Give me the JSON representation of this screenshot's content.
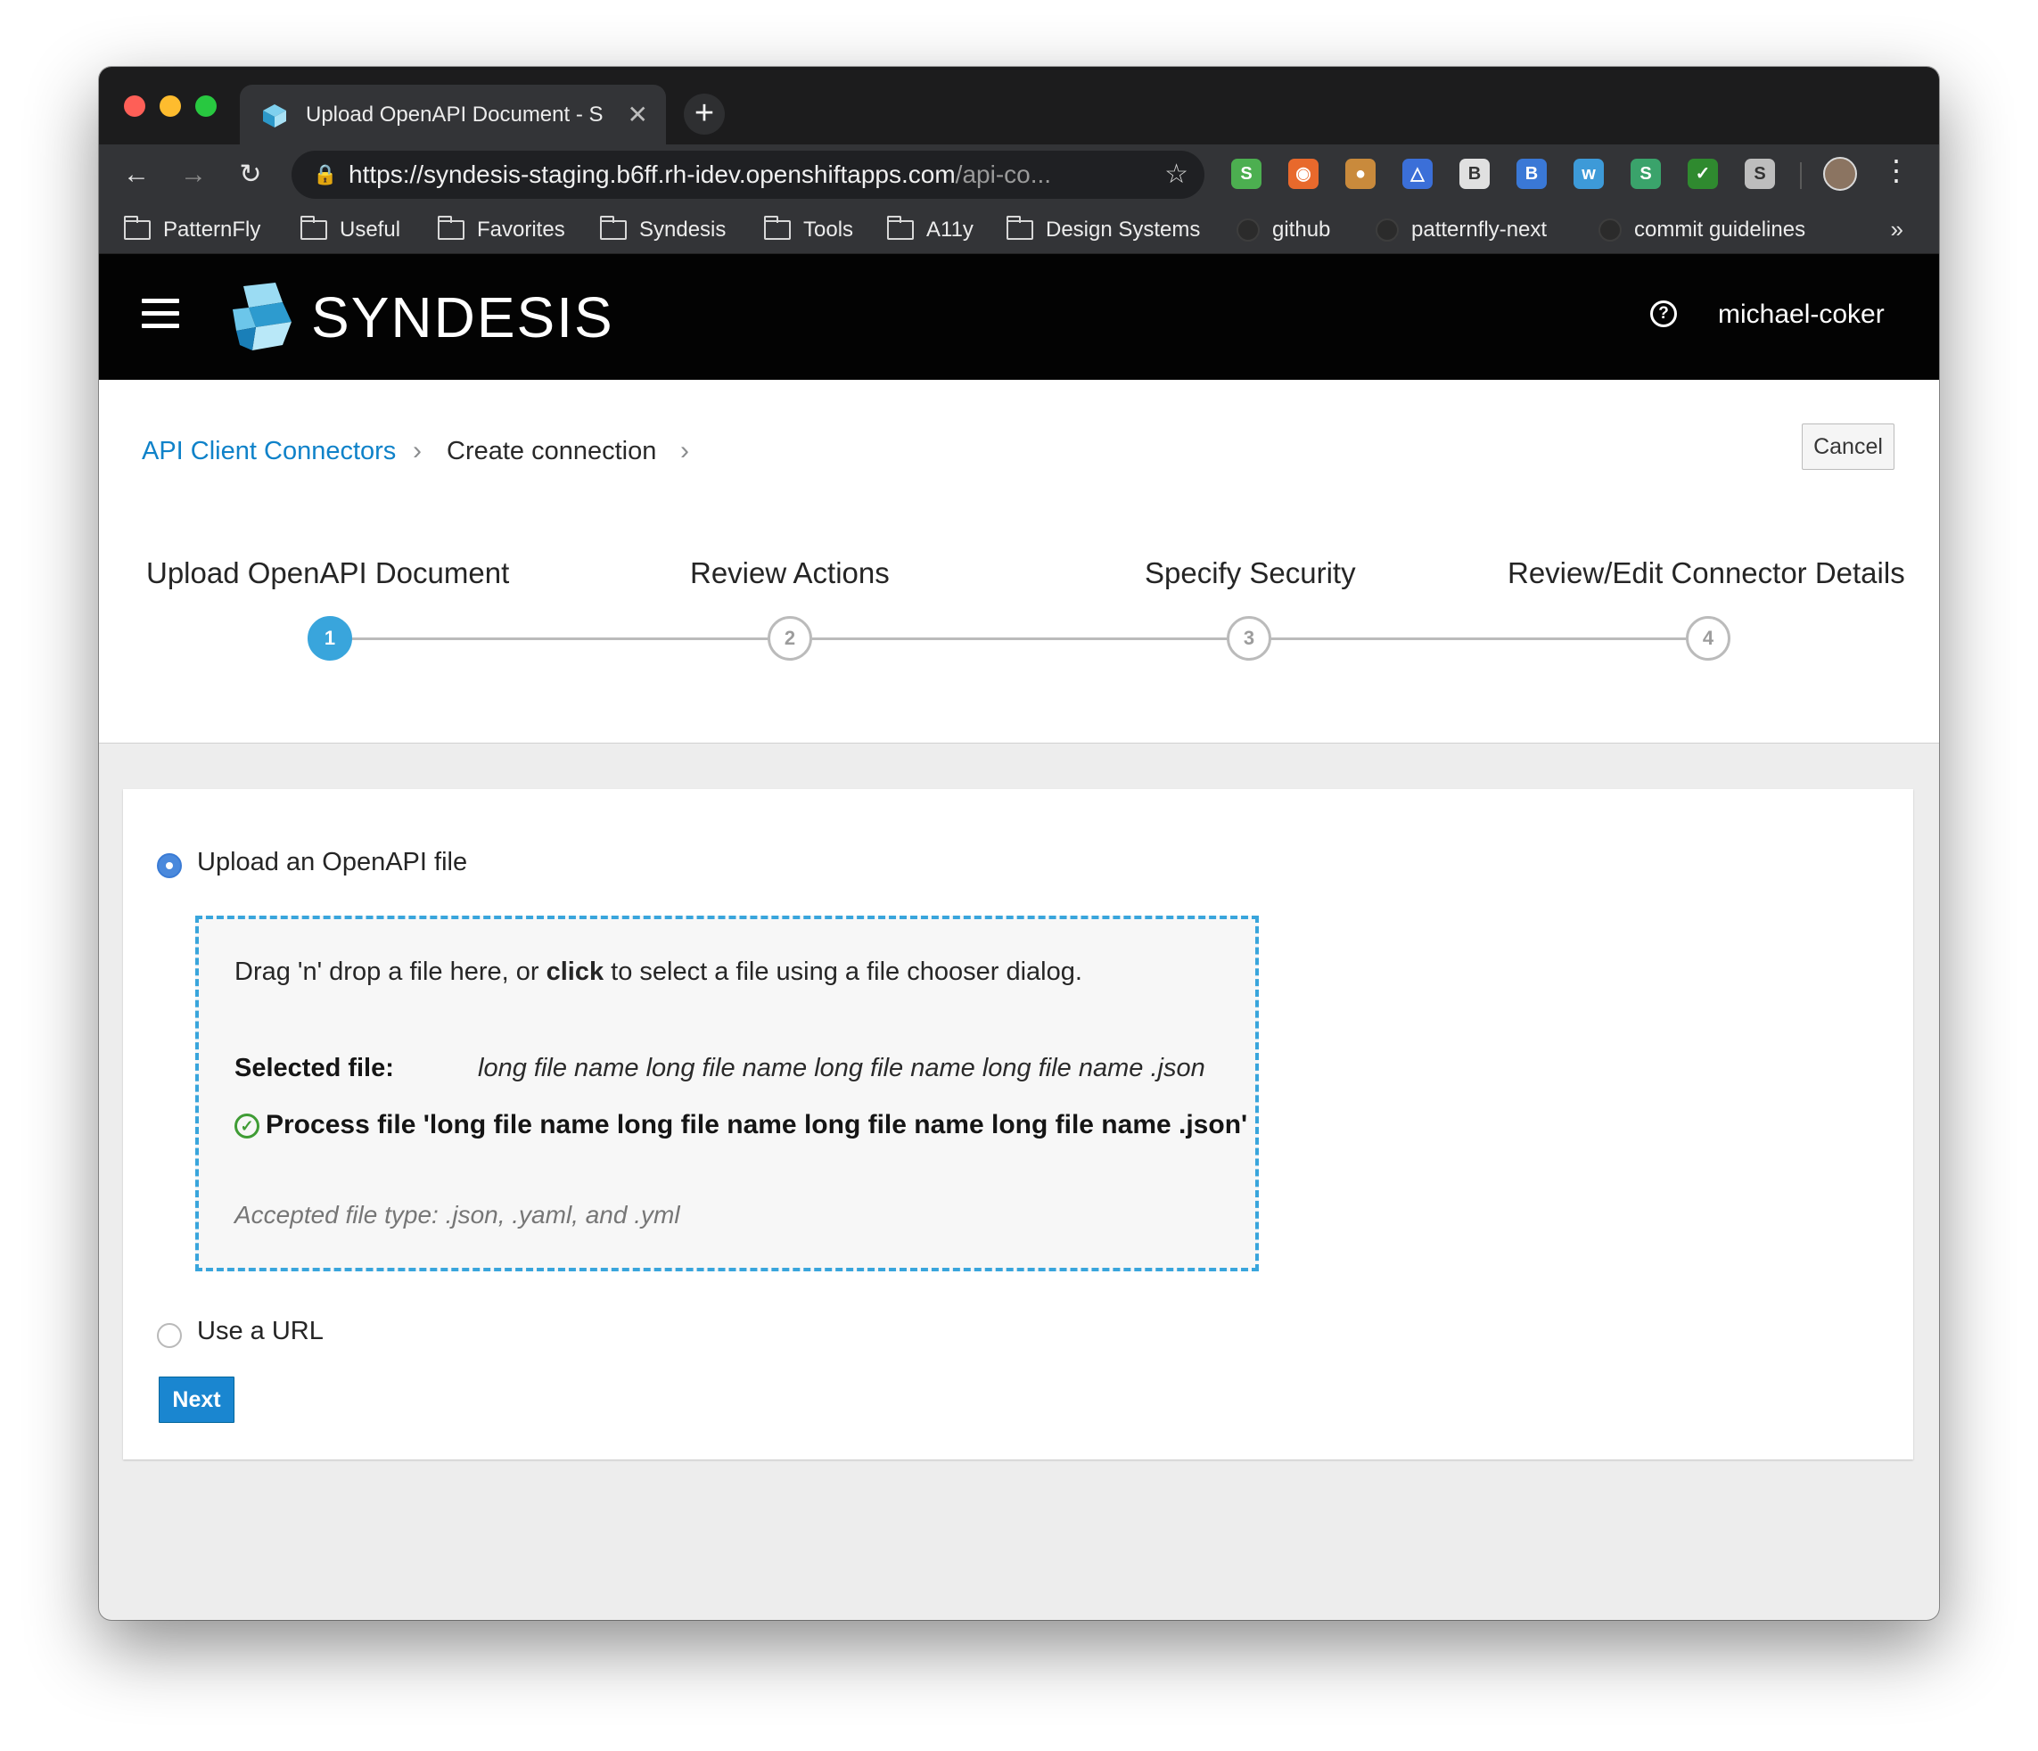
{
  "browser": {
    "tab_title": "Upload OpenAPI Document - S",
    "tab_close": "✕",
    "new_tab": "+",
    "url_main": "https://syndesis-staging.b6ff.rh-idev.openshiftapps.com",
    "url_rest": "/api-co...",
    "back": "←",
    "forward": "→",
    "reload": "↻",
    "lock": "🔒",
    "star": "☆",
    "menu": "⋮",
    "extensions": [
      {
        "name": "s-logo-icon",
        "glyph": "S",
        "color": "#4caf50"
      },
      {
        "name": "firefox-like-icon",
        "glyph": "◉",
        "color": "#e8692c"
      },
      {
        "name": "cookie-icon",
        "glyph": "●",
        "color": "#c98a3c"
      },
      {
        "name": "triangle-icon",
        "glyph": "△",
        "color": "#3b6fd8"
      },
      {
        "name": "b-box-icon",
        "glyph": "B",
        "color": "#e0e0e0"
      },
      {
        "name": "bi-icon",
        "glyph": "B",
        "color": "#3a78d6"
      },
      {
        "name": "walkme-icon",
        "glyph": "w",
        "color": "#3d9ad8"
      },
      {
        "name": "s-green-icon",
        "glyph": "S",
        "color": "#3aa36b"
      },
      {
        "name": "check-icon",
        "glyph": "✓",
        "color": "#2f8a2f"
      },
      {
        "name": "s-gray-icon",
        "glyph": "S",
        "color": "#bdbdbd"
      }
    ]
  },
  "bookmarks": {
    "items": [
      {
        "label": "PatternFly",
        "type": "folder"
      },
      {
        "label": "Useful",
        "type": "folder"
      },
      {
        "label": "Favorites",
        "type": "folder"
      },
      {
        "label": "Syndesis",
        "type": "folder"
      },
      {
        "label": "Tools",
        "type": "folder"
      },
      {
        "label": "A11y",
        "type": "folder"
      },
      {
        "label": "Design Systems",
        "type": "folder"
      },
      {
        "label": "github",
        "type": "github"
      },
      {
        "label": "patternfly-next",
        "type": "github"
      },
      {
        "label": "commit guidelines",
        "type": "github"
      }
    ],
    "more": "»"
  },
  "masthead": {
    "brand": "SYNDESIS",
    "help_glyph": "?",
    "username": "michael-coker"
  },
  "breadcrumb": {
    "link": "API Client Connectors",
    "current": "Create connection",
    "sep": "›"
  },
  "cancel_label": "Cancel",
  "wizard": {
    "steps": [
      {
        "label": "Upload OpenAPI Document",
        "number": "1",
        "active": true
      },
      {
        "label": "Review Actions",
        "number": "2",
        "active": false
      },
      {
        "label": "Specify Security",
        "number": "3",
        "active": false
      },
      {
        "label": "Review/Edit Connector Details",
        "number": "4",
        "active": false
      }
    ]
  },
  "upload": {
    "option_file": "Upload an OpenAPI file",
    "option_url": "Use a URL",
    "drop_prefix": "Drag 'n' drop a file here, or ",
    "drop_bold": "click",
    "drop_suffix": " to select a file using a file chooser dialog.",
    "selected_label": "Selected file:",
    "selected_value": "long file name long file name long file name long file name .json",
    "process_text": "Process file 'long file name long file name long file name long file name .json'",
    "ok_glyph": "✓",
    "accepted": "Accepted file type: .json, .yaml, and .yml",
    "next_label": "Next"
  }
}
